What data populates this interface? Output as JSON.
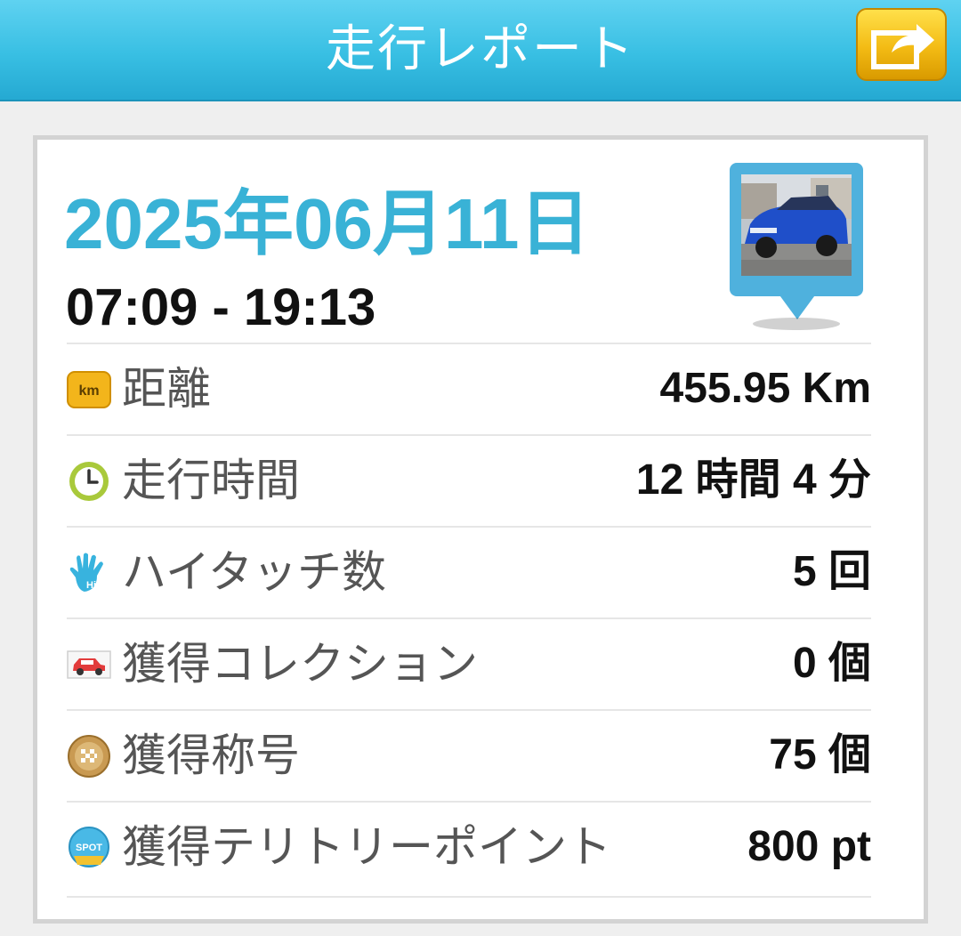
{
  "header": {
    "title": "走行レポート",
    "share_icon": "share-arrow-icon",
    "accent_color": "#38bfe3"
  },
  "report": {
    "date": "2025年06月11日",
    "time_range": "07:09 - 19:13",
    "thumbnail_icon": "car-photo-pin"
  },
  "stats": [
    {
      "icon": "km-icon",
      "label": "距離",
      "value": "455.95 Km"
    },
    {
      "icon": "clock-icon",
      "label": "走行時間",
      "value": "12 時間 4 分"
    },
    {
      "icon": "high-five-hand-icon",
      "label": "ハイタッチ数",
      "value": "5 回"
    },
    {
      "icon": "car-collection-icon",
      "label": "獲得コレクション",
      "value": "0 個"
    },
    {
      "icon": "title-medal-icon",
      "label": "獲得称号",
      "value": "75 個"
    },
    {
      "icon": "spot-badge-icon",
      "label": "獲得テリトリーポイント",
      "value": "800 pt"
    }
  ],
  "icon_text": {
    "km": "km",
    "spot": "SPOT",
    "hi": "Hi"
  }
}
